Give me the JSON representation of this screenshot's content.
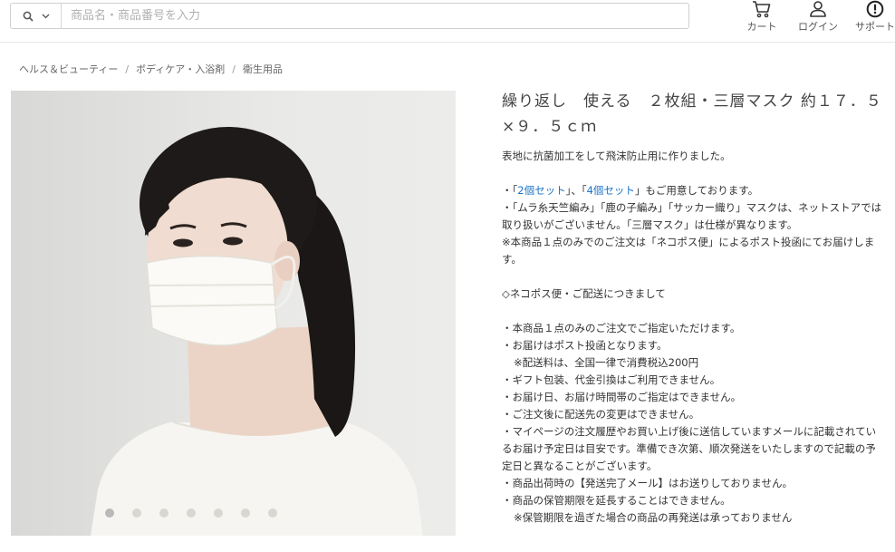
{
  "header": {
    "search_placeholder": "商品名・商品番号を入力",
    "cart_label": "カート",
    "login_label": "ログイン",
    "support_label": "サポート"
  },
  "breadcrumb": [
    "ヘルス＆ビューティー",
    "ボディケア・入浴剤",
    "衛生用品"
  ],
  "breadcrumb_separator": "/",
  "product": {
    "title": "繰り返し　使える　２枚組・三層マスク 約１７．５×９．５ｃｍ",
    "carousel_count": 7,
    "carousel_active_index": 0,
    "description": {
      "intro": "表地に抗菌加工をして飛沫防止用に作りました。",
      "set_prefix": "・「",
      "set_link1": "2個セット",
      "set_mid": "」、「",
      "set_link2": "4個セット",
      "set_suffix": "」もご用意しております。",
      "note1": "・「ムラ糸天竺編み」「鹿の子編み」「サッカー織り」マスクは、ネットストアでは取り扱いがございません。「三層マスク」は仕様が異なります。",
      "note2": "※本商品１点のみでのご注文は「ネコポス便」によるポスト投函にてお届けします。",
      "section_heading": "◇ネコポス便・ご配送につきまして",
      "bullets": [
        "・本商品１点のみのご注文でご指定いただけます。",
        "・お届けはポスト投函となります。",
        "※配送料は、全国一律で消費税込200円",
        "・ギフト包装、代金引換はご利用できません。",
        "・お届け日、お届け時間帯のご指定はできません。",
        "・ご注文後に配送先の変更はできません。",
        "・マイページの注文履歴やお買い上げ後に送信していますメールに記載されているお届け予定日は目安です。準備でき次第、順次発送をいたしますので記載の予定日と異なることがございます。",
        "・商品出荷時の【発送完了メール】はお送りしておりません。",
        "・商品の保管期限を延長することはできません。",
        "※保管期限を過ぎた場合の商品の再発送は承っておりません"
      ]
    }
  },
  "colors": {
    "link": "#1a73c8",
    "text": "#333333",
    "border": "#cfcfcf"
  },
  "icons": [
    "search-icon",
    "chevron-down-icon",
    "cart-icon",
    "user-icon",
    "support-icon"
  ]
}
